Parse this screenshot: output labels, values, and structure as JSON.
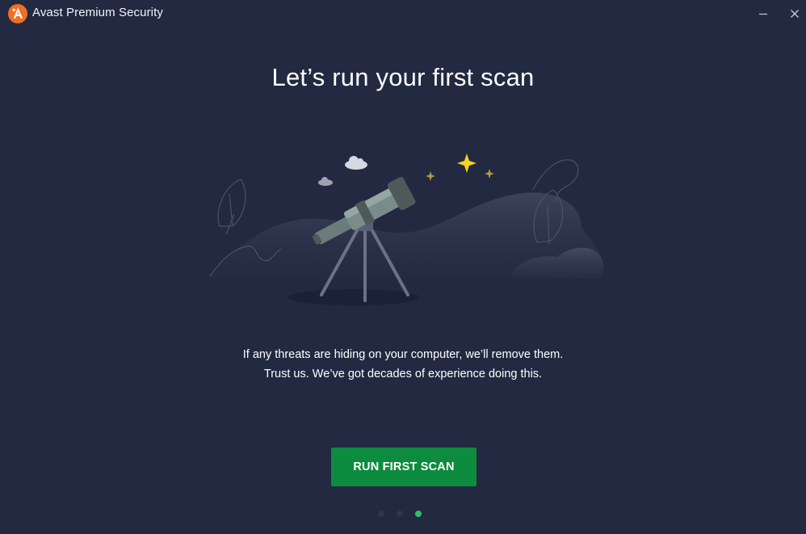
{
  "window": {
    "title": "Avast Premium Security",
    "logo_icon": "avast-logo-icon",
    "minimize_icon": "minimize-icon",
    "close_icon": "close-icon"
  },
  "main": {
    "headline": "Let’s run your first scan",
    "illustration": "telescope-illustration",
    "description_line1": "If any threats are hiding on your computer, we’ll remove them.",
    "description_line2": "Trust us. We’ve got decades of experience doing this.",
    "cta_label": "RUN FIRST SCAN"
  },
  "pagination": {
    "total": 3,
    "active_index": 3
  },
  "colors": {
    "background": "#222941",
    "brand_orange": "#f26d21",
    "cta_green": "#0d8b3e",
    "active_dot": "#2bc16a",
    "star_yellow": "#f6d31d"
  }
}
